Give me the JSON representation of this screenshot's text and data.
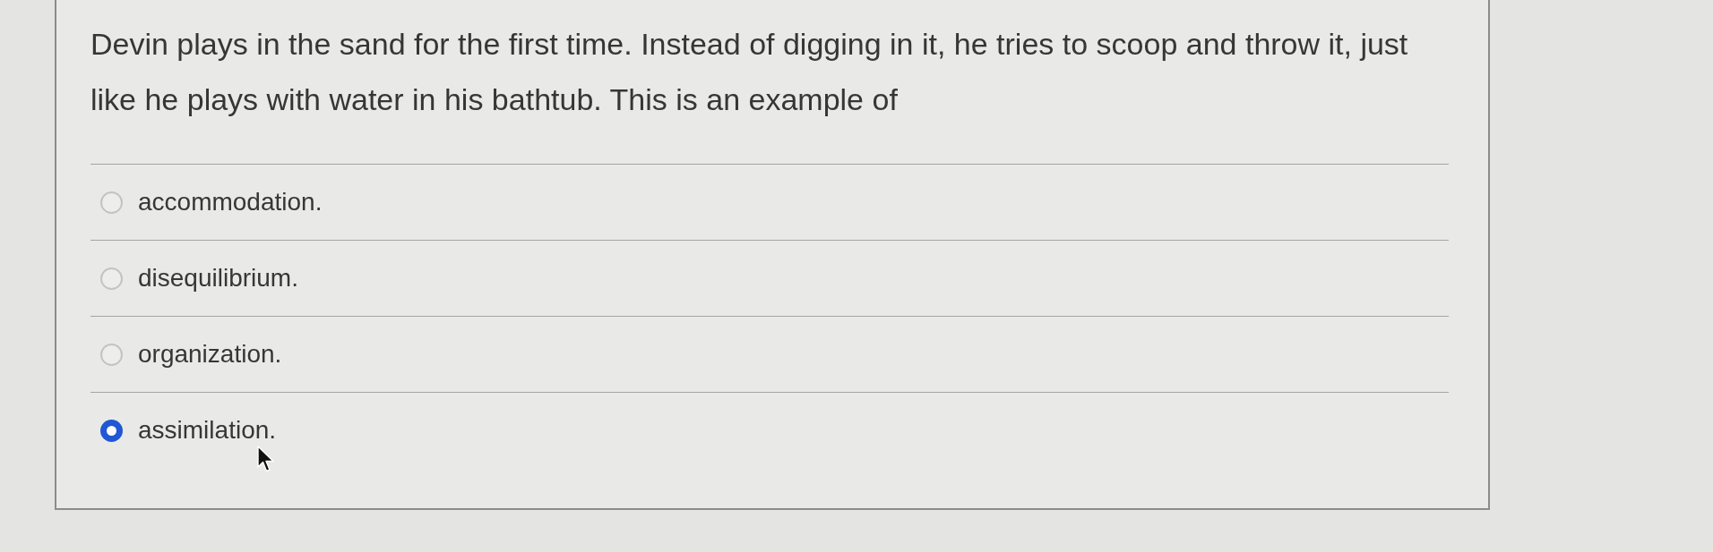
{
  "question": {
    "text": "Devin plays in the sand for the first time. Instead of digging in it, he tries to scoop and throw it, just like he plays with water in his bathtub. This is an example of"
  },
  "options": [
    {
      "label": "accommodation.",
      "selected": false
    },
    {
      "label": "disequilibrium.",
      "selected": false
    },
    {
      "label": "organization.",
      "selected": false
    },
    {
      "label": "assimilation.",
      "selected": true
    }
  ]
}
